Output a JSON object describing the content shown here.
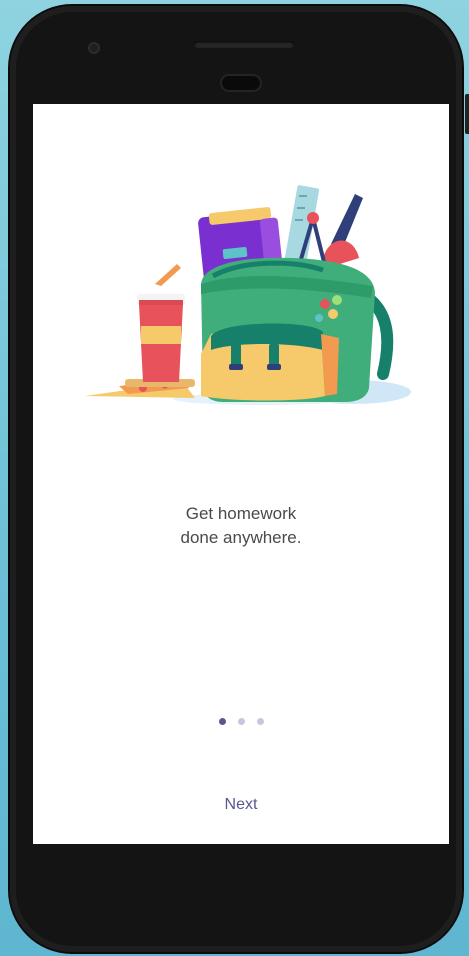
{
  "onboarding": {
    "headline_line1": "Get homework",
    "headline_line2": "done anywhere.",
    "illustration_icon": "backpack-with-school-supplies-icon",
    "pagination": {
      "total": 3,
      "active_index": 0
    },
    "next_label": "Next"
  },
  "colors": {
    "accent": "#5a578e",
    "dot_inactive": "#c8c6de",
    "headline_text": "#4a4a4a",
    "backpack_green": "#3fae7a",
    "backpack_dark_green": "#17806a",
    "pocket_yellow": "#f6c96a",
    "book_purple": "#7a2fd0",
    "cup_red": "#e8525a"
  }
}
